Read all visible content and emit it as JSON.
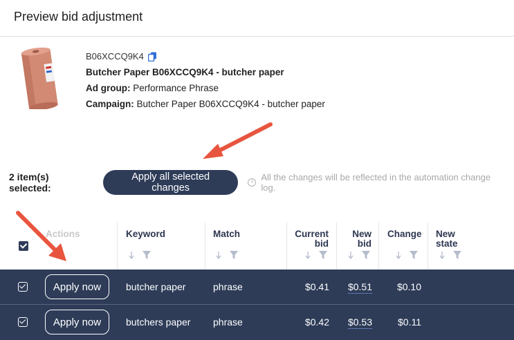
{
  "header": {
    "title": "Preview bid adjustment"
  },
  "product": {
    "asin": "B06XCCQ9K4",
    "name": "Butcher Paper B06XCCQ9K4 - butcher paper",
    "ad_group_label": "Ad group:",
    "ad_group_value": "Performance Phrase",
    "campaign_label": "Campaign:",
    "campaign_value": "Butcher Paper B06XCCQ9K4 - butcher paper"
  },
  "selection": {
    "label": "2 item(s) selected:",
    "apply_all_label": "Apply all selected changes",
    "info_text": "All the changes will be reflected in the automation change log."
  },
  "table": {
    "columns": {
      "actions": "Actions",
      "keyword": "Keyword",
      "match": "Match",
      "current_bid_1": "Current",
      "current_bid_2": "bid",
      "new_bid_1": "New",
      "new_bid_2": "bid",
      "change": "Change",
      "new_state_1": "New",
      "new_state_2": "state"
    },
    "rows": [
      {
        "action": "Apply now",
        "keyword": "butcher paper",
        "match": "phrase",
        "current_bid": "$0.41",
        "new_bid": "$0.51",
        "change": "$0.10"
      },
      {
        "action": "Apply now",
        "keyword": "butchers paper",
        "match": "phrase",
        "current_bid": "$0.42",
        "new_bid": "$0.53",
        "change": "$0.11"
      }
    ]
  },
  "colors": {
    "primary": "#2e3c58",
    "arrow": "#e8553e"
  }
}
